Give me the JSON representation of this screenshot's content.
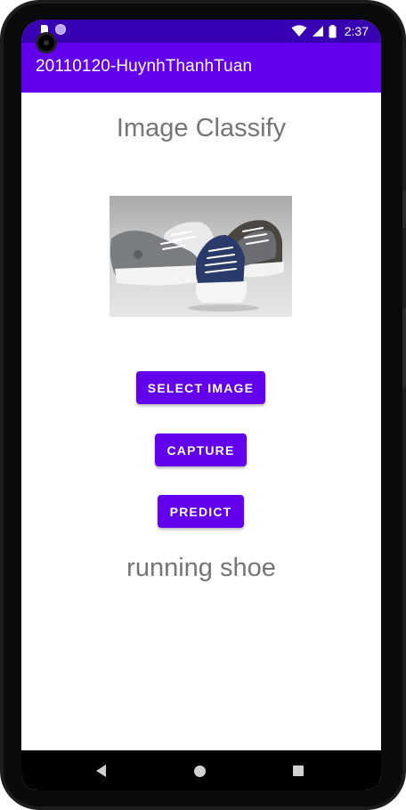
{
  "status_bar": {
    "time": "2:37",
    "icons": [
      "sim-card-icon",
      "notification-dot-icon",
      "wifi-icon",
      "cell-signal-icon",
      "battery-icon"
    ]
  },
  "app_bar": {
    "title": "20110120-HuynhThanhTuan"
  },
  "main": {
    "heading": "Image Classify",
    "image_subject": "shoes-photo",
    "buttons": {
      "select_image": "SELECT IMAGE",
      "capture": "CAPTURE",
      "predict": "PREDICT"
    },
    "result": "running shoe"
  },
  "nav_bar": {
    "icons": [
      "back-icon",
      "home-icon",
      "recents-icon"
    ]
  },
  "colors": {
    "status_bar": "#3700b3",
    "app_bar": "#6200ee",
    "button": "#6200ee",
    "text_gray": "#757575"
  }
}
